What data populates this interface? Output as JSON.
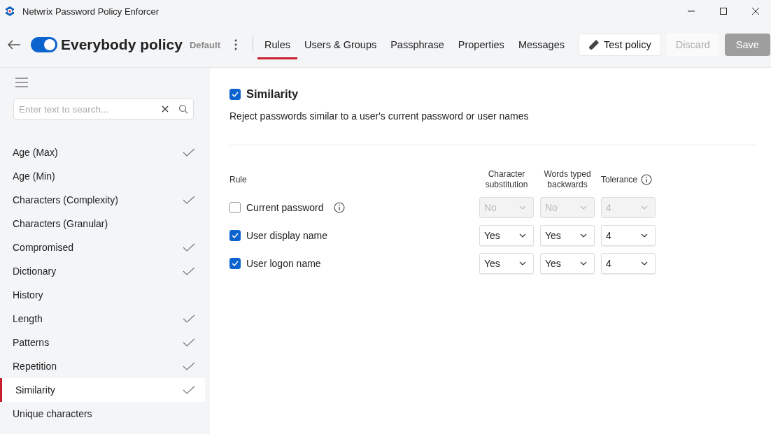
{
  "window": {
    "title": "Netwrix Password Policy Enforcer"
  },
  "header": {
    "enabled": true,
    "policy_name": "Everybody policy",
    "badge": "Default",
    "tabs": [
      {
        "label": "Rules",
        "selected": true
      },
      {
        "label": "Users & Groups",
        "selected": false
      },
      {
        "label": "Passphrase",
        "selected": false
      },
      {
        "label": "Properties",
        "selected": false
      },
      {
        "label": "Messages",
        "selected": false
      }
    ],
    "buttons": [
      {
        "label": "Test policy",
        "kind": "test",
        "disabled": false
      },
      {
        "label": "Discard",
        "kind": "secondary",
        "disabled": true
      },
      {
        "label": "Save",
        "kind": "primary",
        "disabled": true
      }
    ]
  },
  "sidebar": {
    "search": {
      "placeholder": "Enter text to search..."
    },
    "items": [
      {
        "label": "Age (Max)",
        "done": true,
        "selected": false
      },
      {
        "label": "Age (Min)",
        "done": false,
        "selected": false
      },
      {
        "label": "Characters (Complexity)",
        "done": true,
        "selected": false
      },
      {
        "label": "Characters (Granular)",
        "done": false,
        "selected": false
      },
      {
        "label": "Compromised",
        "done": true,
        "selected": false
      },
      {
        "label": "Dictionary",
        "done": true,
        "selected": false
      },
      {
        "label": "History",
        "done": false,
        "selected": false
      },
      {
        "label": "Length",
        "done": true,
        "selected": false
      },
      {
        "label": "Patterns",
        "done": true,
        "selected": false
      },
      {
        "label": "Repetition",
        "done": true,
        "selected": false
      },
      {
        "label": "Similarity",
        "done": true,
        "selected": true
      },
      {
        "label": "Unique characters",
        "done": false,
        "selected": false
      }
    ]
  },
  "content": {
    "title": "Similarity",
    "enabled": true,
    "description": "Reject passwords similar to a user's current password or user names",
    "columns": [
      "Rule",
      "Character substitution",
      "Words typed backwards",
      "Tolerance"
    ],
    "rows": [
      {
        "label": "Current password",
        "info": true,
        "checked": false,
        "values": [
          "No",
          "No",
          "4"
        ]
      },
      {
        "label": "User display name",
        "info": false,
        "checked": true,
        "values": [
          "Yes",
          "Yes",
          "4"
        ]
      },
      {
        "label": "User logon name",
        "info": false,
        "checked": true,
        "values": [
          "Yes",
          "Yes",
          "4"
        ]
      }
    ]
  }
}
